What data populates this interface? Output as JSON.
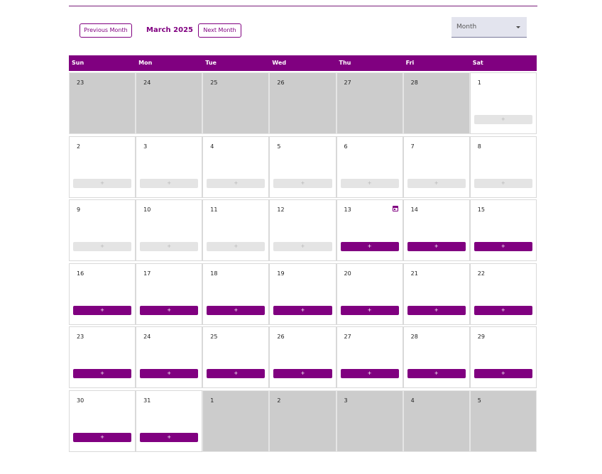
{
  "toolbar": {
    "prev_label": "Previous Month",
    "next_label": "Next Month",
    "month_title": "March 2025",
    "view_select": "Month"
  },
  "colors": {
    "accent": "#800080",
    "disabled_day": "#cccccc"
  },
  "weekdays": [
    "Sun",
    "Mon",
    "Tue",
    "Wed",
    "Thu",
    "Fri",
    "Sat"
  ],
  "add_label": "+",
  "weeks": [
    [
      {
        "day": "23",
        "other": true
      },
      {
        "day": "24",
        "other": true
      },
      {
        "day": "25",
        "other": true
      },
      {
        "day": "26",
        "other": true
      },
      {
        "day": "27",
        "other": true
      },
      {
        "day": "28",
        "other": true
      },
      {
        "day": "1",
        "add": "disabled"
      }
    ],
    [
      {
        "day": "2",
        "add": "disabled"
      },
      {
        "day": "3",
        "add": "disabled"
      },
      {
        "day": "4",
        "add": "disabled"
      },
      {
        "day": "5",
        "add": "disabled"
      },
      {
        "day": "6",
        "add": "disabled"
      },
      {
        "day": "7",
        "add": "disabled"
      },
      {
        "day": "8",
        "add": "disabled"
      }
    ],
    [
      {
        "day": "9",
        "add": "disabled"
      },
      {
        "day": "10",
        "add": "disabled"
      },
      {
        "day": "11",
        "add": "disabled"
      },
      {
        "day": "12",
        "add": "disabled"
      },
      {
        "day": "13",
        "add": "enabled",
        "today": true
      },
      {
        "day": "14",
        "add": "enabled"
      },
      {
        "day": "15",
        "add": "enabled"
      }
    ],
    [
      {
        "day": "16",
        "add": "enabled"
      },
      {
        "day": "17",
        "add": "enabled"
      },
      {
        "day": "18",
        "add": "enabled"
      },
      {
        "day": "19",
        "add": "enabled"
      },
      {
        "day": "20",
        "add": "enabled"
      },
      {
        "day": "21",
        "add": "enabled"
      },
      {
        "day": "22",
        "add": "enabled"
      }
    ],
    [
      {
        "day": "23",
        "add": "enabled"
      },
      {
        "day": "24",
        "add": "enabled"
      },
      {
        "day": "25",
        "add": "enabled"
      },
      {
        "day": "26",
        "add": "enabled"
      },
      {
        "day": "27",
        "add": "enabled"
      },
      {
        "day": "28",
        "add": "enabled"
      },
      {
        "day": "29",
        "add": "enabled"
      }
    ],
    [
      {
        "day": "30",
        "add": "enabled"
      },
      {
        "day": "31",
        "add": "enabled"
      },
      {
        "day": "1",
        "other": true
      },
      {
        "day": "2",
        "other": true
      },
      {
        "day": "3",
        "other": true
      },
      {
        "day": "4",
        "other": true
      },
      {
        "day": "5",
        "other": true
      }
    ]
  ]
}
